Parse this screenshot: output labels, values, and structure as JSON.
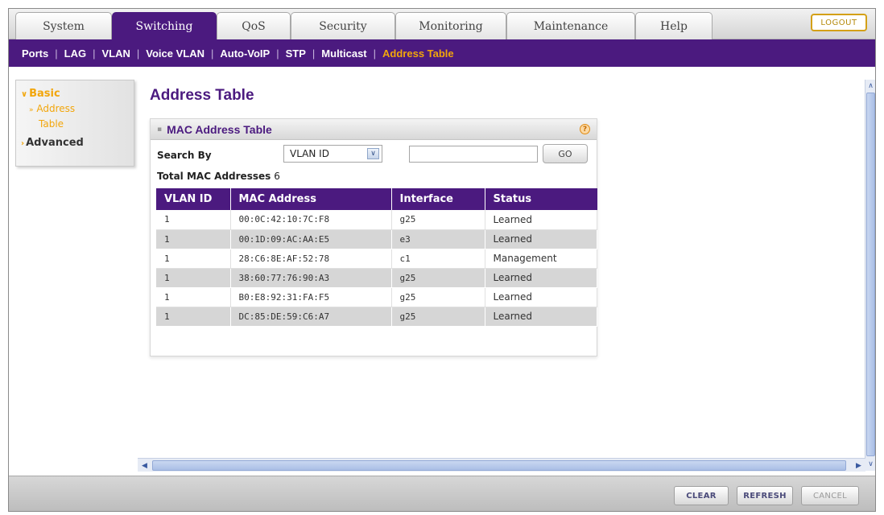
{
  "tabs": [
    {
      "label": "System"
    },
    {
      "label": "Switching"
    },
    {
      "label": "QoS"
    },
    {
      "label": "Security"
    },
    {
      "label": "Monitoring"
    },
    {
      "label": "Maintenance"
    },
    {
      "label": "Help"
    }
  ],
  "active_tab": "Switching",
  "logout_label": "LOGOUT",
  "subnav": [
    {
      "label": "Ports"
    },
    {
      "label": "LAG"
    },
    {
      "label": "VLAN"
    },
    {
      "label": "Voice VLAN"
    },
    {
      "label": "Auto-VoIP"
    },
    {
      "label": "STP"
    },
    {
      "label": "Multicast"
    },
    {
      "label": "Address Table"
    }
  ],
  "active_subnav": "Address Table",
  "sidebar": {
    "basic": "Basic",
    "address_table_line1": "Address",
    "address_table_line2": "Table",
    "advanced": "Advanced"
  },
  "page_title": "Address Table",
  "panel": {
    "title": "MAC Address Table",
    "help_icon": "help-icon",
    "search_by_label": "Search By",
    "search_by_value": "VLAN ID",
    "search_value": "",
    "go_label": "GO",
    "total_label": "Total MAC Addresses",
    "total_count": "6"
  },
  "table": {
    "headers": [
      "VLAN ID",
      "MAC Address",
      "Interface",
      "Status"
    ],
    "rows": [
      [
        "1",
        "00:0C:42:10:7C:F8",
        "g25",
        "Learned"
      ],
      [
        "1",
        "00:1D:09:AC:AA:E5",
        "e3",
        "Learned"
      ],
      [
        "1",
        "28:C6:8E:AF:52:78",
        "c1",
        "Management"
      ],
      [
        "1",
        "38:60:77:76:90:A3",
        "g25",
        "Learned"
      ],
      [
        "1",
        "B0:E8:92:31:FA:F5",
        "g25",
        "Learned"
      ],
      [
        "1",
        "DC:85:DE:59:C6:A7",
        "g25",
        "Learned"
      ]
    ]
  },
  "buttons": {
    "clear": "CLEAR",
    "refresh": "REFRESH",
    "cancel": "CANCEL"
  },
  "colors": {
    "brand_purple": "#4b1a7f",
    "accent_orange": "#f2a60b"
  }
}
